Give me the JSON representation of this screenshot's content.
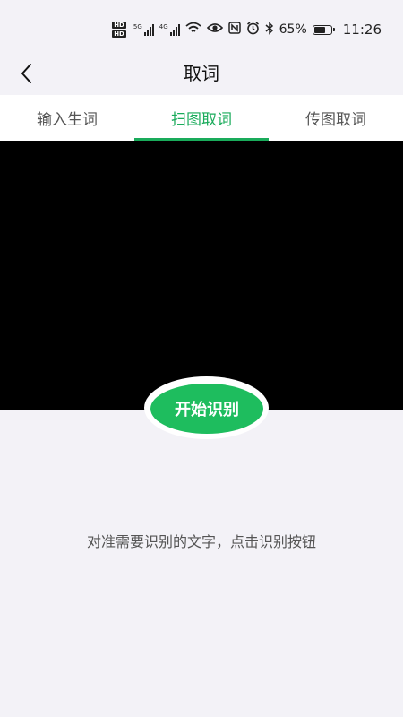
{
  "status_bar": {
    "hd1": "HD",
    "hd2": "HD",
    "net1": "5G",
    "net2": "4G",
    "battery_percent": "65%",
    "time": "11:26",
    "icons": [
      "wifi-icon",
      "eye-icon",
      "nfc-icon",
      "alarm-icon",
      "bluetooth-icon",
      "battery-icon"
    ]
  },
  "header": {
    "title": "取词",
    "back_icon": "chevron-left-icon"
  },
  "tabs": [
    {
      "label": "输入生词",
      "active": false
    },
    {
      "label": "扫图取词",
      "active": true
    },
    {
      "label": "传图取词",
      "active": false
    }
  ],
  "scan_button": {
    "label": "开始识别"
  },
  "hint": "对准需要识别的文字，点击识别按钮",
  "colors": {
    "accent": "#1aab5b",
    "button": "#1ebd5e",
    "background": "#f3f2f7",
    "camera": "#000000"
  }
}
